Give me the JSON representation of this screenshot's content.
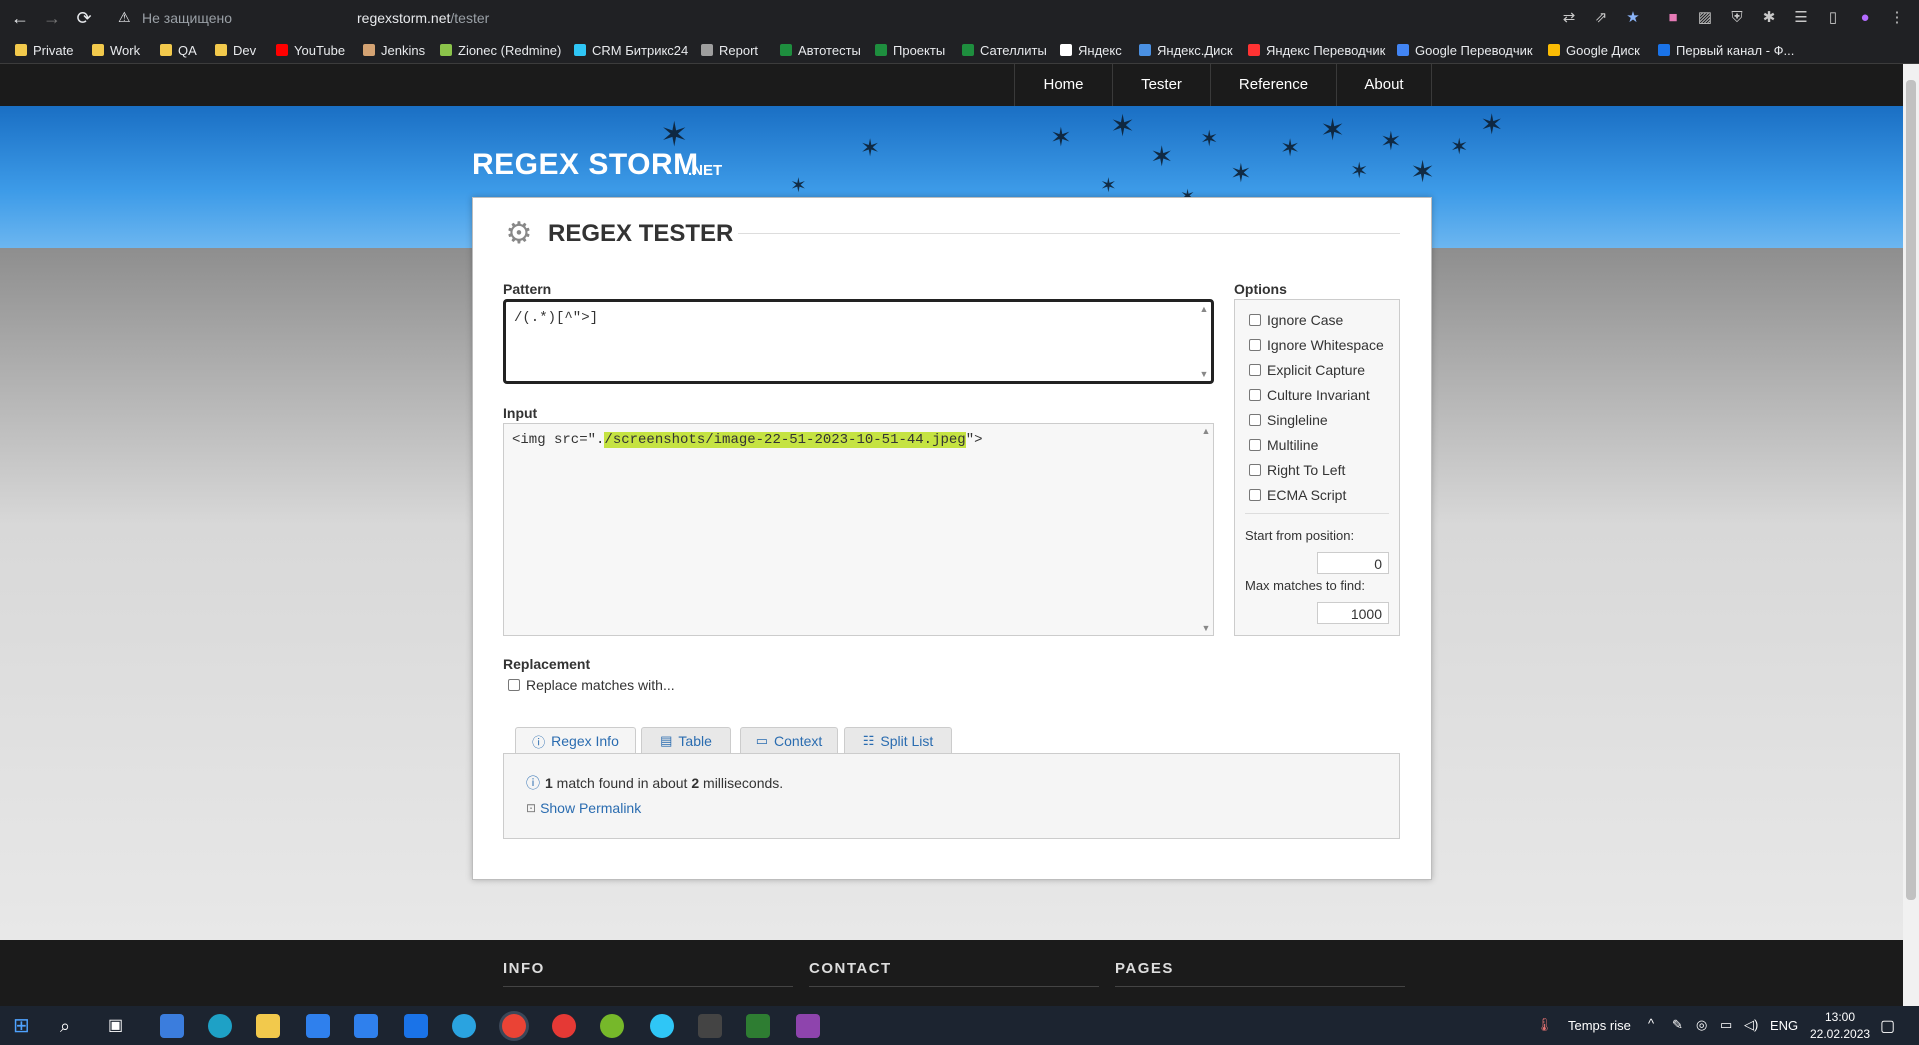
{
  "browser": {
    "security_label": "Не защищено",
    "url_host": "regexstorm.net",
    "url_path": "/tester"
  },
  "bookmarks": [
    {
      "label": "Private",
      "color": "#f2c94c"
    },
    {
      "label": "Work",
      "color": "#f2c94c"
    },
    {
      "label": "QA",
      "color": "#f2c94c"
    },
    {
      "label": "Dev",
      "color": "#f2c94c"
    },
    {
      "label": "YouTube",
      "color": "#ff0000"
    },
    {
      "label": "Jenkins",
      "color": "#d4a373"
    },
    {
      "label": "Zionec (Redmine)",
      "color": "#8bc34a"
    },
    {
      "label": "CRM Битрикс24",
      "color": "#2fc6f6"
    },
    {
      "label": "Report",
      "color": "#9e9e9e"
    },
    {
      "label": "Автотесты",
      "color": "#1e8e3e"
    },
    {
      "label": "Проекты",
      "color": "#1e8e3e"
    },
    {
      "label": "Сателлиты",
      "color": "#1e8e3e"
    },
    {
      "label": "Яндекс",
      "color": "#ffffff"
    },
    {
      "label": "Яндекс.Диск",
      "color": "#4a90e2"
    },
    {
      "label": "Яндекс Переводчик",
      "color": "#ff3333"
    },
    {
      "label": "Google Переводчик",
      "color": "#4285f4"
    },
    {
      "label": "Google Диск",
      "color": "#fbbc04"
    },
    {
      "label": "Первый канал - Ф...",
      "color": "#1a73e8"
    }
  ],
  "site_nav": [
    "Home",
    "Tester",
    "Reference",
    "About"
  ],
  "site": {
    "logo": "REGEX STORM",
    "logo_suffix": ".NET",
    "title": "REGEX TESTER"
  },
  "pattern": {
    "label": "Pattern",
    "value": "/(.*)[^\">]"
  },
  "input": {
    "label": "Input",
    "before": "<img src=\".",
    "match": "/screenshots/image-22-51-2023-10-51-44.jpeg",
    "after": "\">"
  },
  "options": {
    "label": "Options",
    "checkboxes": [
      "Ignore Case",
      "Ignore Whitespace",
      "Explicit Capture",
      "Culture Invariant",
      "Singleline",
      "Multiline",
      "Right To Left",
      "ECMA Script"
    ],
    "start_label": "Start from position:",
    "start_value": "0",
    "max_label": "Max matches to find:",
    "max_value": "1000"
  },
  "replacement": {
    "label": "Replacement",
    "checkbox": "Replace matches with..."
  },
  "tabs": [
    "Regex Info",
    "Table",
    "Context",
    "Split List"
  ],
  "info": {
    "count": "1",
    "text1": " match found in about ",
    "ms": "2",
    "text2": " milliseconds.",
    "permalink": "Show Permalink"
  },
  "footer": {
    "headings": [
      "INFO",
      "CONTACT",
      "PAGES"
    ]
  },
  "taskbar": {
    "weather": "Temps rise",
    "lang": "ENG",
    "time": "13:00",
    "date": "22.02.2023"
  }
}
